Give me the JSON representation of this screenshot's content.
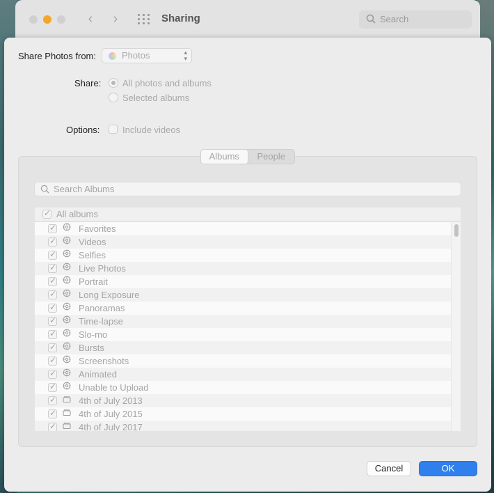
{
  "background_window": {
    "title": "Sharing",
    "search_placeholder": "Search",
    "nav_back_glyph": "‹",
    "nav_forward_glyph": "›"
  },
  "sheet": {
    "share_from_label": "Share Photos from:",
    "share_from_value": "Photos",
    "share_label": "Share:",
    "share_options": [
      "All photos and albums",
      "Selected albums"
    ],
    "options_label": "Options:",
    "include_videos_label": "Include videos",
    "tabs": [
      "Albums",
      "People"
    ],
    "search_albums_placeholder": "Search Albums",
    "all_albums_label": "All albums",
    "albums": [
      {
        "name": "Favorites",
        "icon": "smart-album-gear-icon"
      },
      {
        "name": "Videos",
        "icon": "smart-album-gear-icon"
      },
      {
        "name": "Selfies",
        "icon": "smart-album-gear-icon"
      },
      {
        "name": "Live Photos",
        "icon": "smart-album-gear-icon"
      },
      {
        "name": "Portrait",
        "icon": "smart-album-gear-icon"
      },
      {
        "name": "Long Exposure",
        "icon": "smart-album-gear-icon"
      },
      {
        "name": "Panoramas",
        "icon": "smart-album-gear-icon"
      },
      {
        "name": "Time-lapse",
        "icon": "smart-album-gear-icon"
      },
      {
        "name": "Slo-mo",
        "icon": "smart-album-gear-icon"
      },
      {
        "name": "Bursts",
        "icon": "smart-album-gear-icon"
      },
      {
        "name": "Screenshots",
        "icon": "smart-album-gear-icon"
      },
      {
        "name": "Animated",
        "icon": "smart-album-gear-icon"
      },
      {
        "name": "Unable to Upload",
        "icon": "smart-album-gear-icon"
      },
      {
        "name": "4th of July 2013",
        "icon": "album-folder-icon"
      },
      {
        "name": "4th of July 2015",
        "icon": "album-folder-icon"
      },
      {
        "name": "4th of July 2017",
        "icon": "album-folder-icon"
      }
    ],
    "cancel_label": "Cancel",
    "ok_label": "OK"
  },
  "colors": {
    "accent": "#2f80ed",
    "disabled_text": "#a9a9a9",
    "minimize_button": "#f5a623"
  }
}
